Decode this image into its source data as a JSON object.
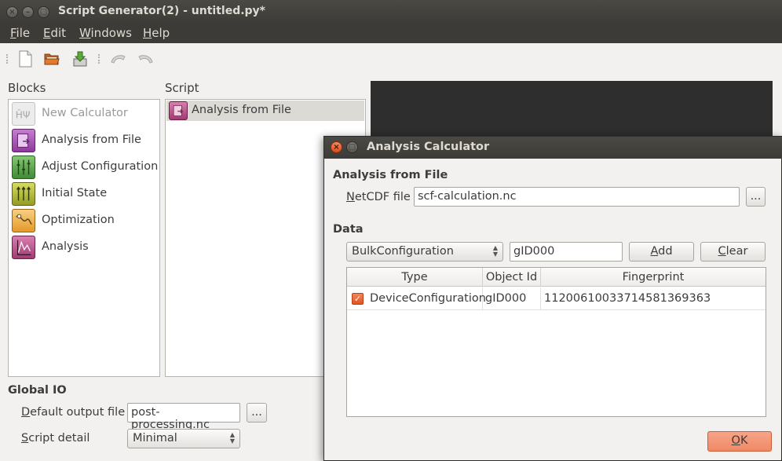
{
  "window": {
    "title": "Script Generator(2) - untitled.py*",
    "menu": [
      {
        "mnemonic": "F",
        "rest": "ile"
      },
      {
        "mnemonic": "E",
        "rest": "dit"
      },
      {
        "mnemonic": "W",
        "rest": "indows"
      },
      {
        "mnemonic": "H",
        "rest": "elp"
      }
    ]
  },
  "toolbar": {
    "icons": [
      "new-file-icon",
      "open-folder-icon",
      "save-download-icon",
      "undo-icon",
      "redo-icon"
    ]
  },
  "blocks": {
    "label": "Blocks",
    "items": [
      {
        "label": "New Calculator",
        "icon": "calculator-icon",
        "color": "#e8e8e8",
        "disabled": true
      },
      {
        "label": "Analysis from File",
        "icon": "analysis-file-icon",
        "color": "#a44fb0"
      },
      {
        "label": "Adjust Configuration",
        "icon": "adjust-icon",
        "color": "#5aa64b"
      },
      {
        "label": "Initial State",
        "icon": "initial-state-icon",
        "color": "#b6c23a"
      },
      {
        "label": "Optimization",
        "icon": "optimization-icon",
        "color": "#f0b24a"
      },
      {
        "label": "Analysis",
        "icon": "analysis-icon",
        "color": "#c0558f"
      }
    ]
  },
  "script": {
    "label": "Script",
    "items": [
      {
        "label": "Analysis from File",
        "color": "#b94f8c"
      }
    ]
  },
  "global_io": {
    "label": "Global IO",
    "output_file": {
      "mnemonic": "D",
      "rest": "efault output file",
      "value": "post-processing.nc",
      "browse": "..."
    },
    "script_detail": {
      "mnemonic": "S",
      "rest": "cript detail",
      "value": "Minimal"
    }
  },
  "dialog": {
    "title": "Analysis Calculator",
    "section_analysis": "Analysis from File",
    "netcdf": {
      "mnemonic": "N",
      "rest": "etCDF file",
      "value": "scf-calculation.nc",
      "browse": "..."
    },
    "section_data": "Data",
    "data_type": "BulkConfiguration",
    "data_id": "gID000",
    "add": {
      "mnemonic": "A",
      "rest": "dd"
    },
    "clear": {
      "mnemonic": "C",
      "rest": "lear"
    },
    "table": {
      "headers": [
        "Type",
        "Object Id",
        "Fingerprint"
      ],
      "rows": [
        {
          "type": "DeviceConfiguration",
          "object_id": "gID000",
          "fingerprint": "11200610033714581369363",
          "checked": true
        }
      ]
    },
    "ok": {
      "mnemonic": "O",
      "rest": "K"
    }
  }
}
